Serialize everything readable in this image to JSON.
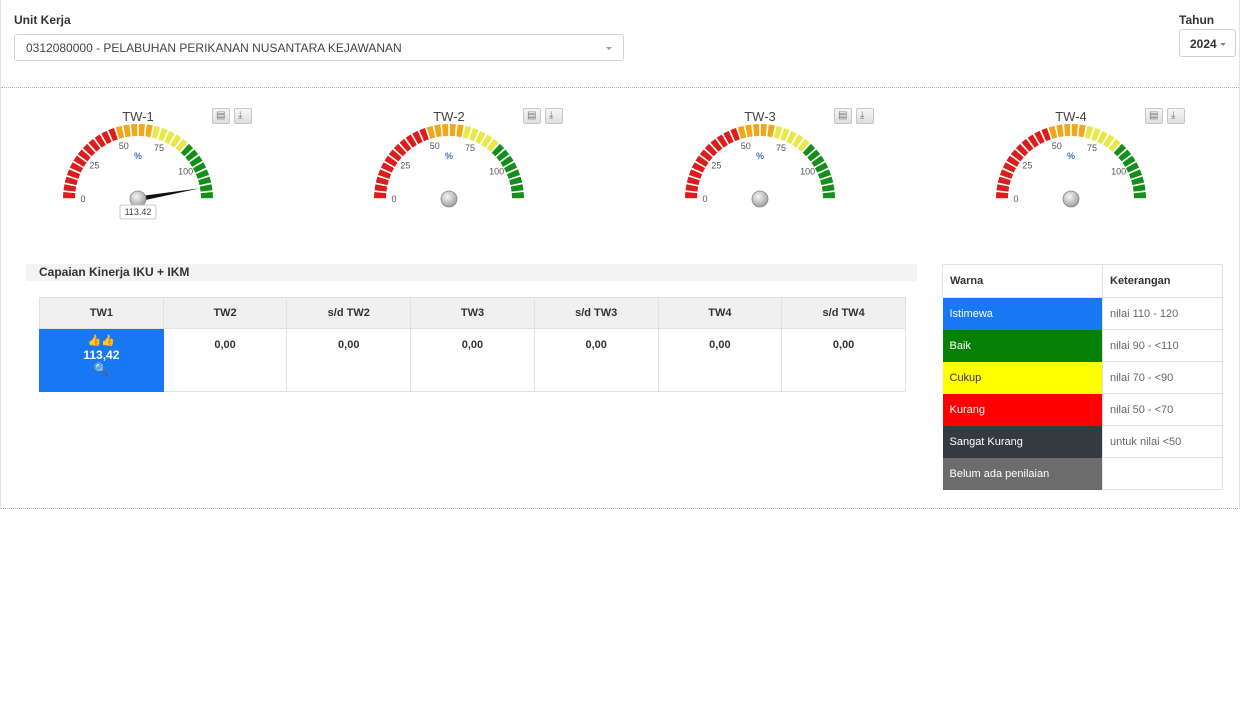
{
  "filter": {
    "unit_label": "Unit Kerja",
    "unit_value": "0312080000 - PELABUHAN PERIKANAN NUSANTARA KEJAWANAN",
    "year_label": "Tahun",
    "year_value": "2024"
  },
  "gauge_scale": {
    "min": 0,
    "max": 120,
    "tick_labels": [
      "0",
      "25",
      "50",
      "75",
      "100"
    ],
    "unit": "%"
  },
  "gauges": [
    {
      "title": "TW-1",
      "value": 113.42,
      "value_label": "113.42"
    },
    {
      "title": "TW-2",
      "value": null,
      "value_label": ""
    },
    {
      "title": "TW-3",
      "value": null,
      "value_label": ""
    },
    {
      "title": "TW-4",
      "value": null,
      "value_label": ""
    }
  ],
  "gauge_colors": {
    "red": "#dd1c1c",
    "orange": "#f0a81a",
    "yellow": "#e8e84a",
    "green": "#148f1a"
  },
  "gauge_buttons": {
    "print_icon": "printer-icon",
    "download_icon": "download-icon"
  },
  "performance": {
    "title": "Capaian Kinerja IKU + IKM",
    "headers": [
      "TW1",
      "TW2",
      "s/d TW2",
      "TW3",
      "s/d TW3",
      "TW4",
      "s/d TW4"
    ],
    "values": [
      "113,42",
      "0,00",
      "0,00",
      "0,00",
      "0,00",
      "0,00",
      "0,00"
    ],
    "highlight_color": "#1877f2",
    "highlight_icons": [
      "thumbs-up-icon",
      "search-icon"
    ]
  },
  "legend": {
    "headers": [
      "Warna",
      "Keterangan"
    ],
    "rows": [
      {
        "name": "Istimewa",
        "desc": "nilai 110 - 120",
        "color": "#1877f2"
      },
      {
        "name": "Baik",
        "desc": "nilai 90 - <110",
        "color": "#078007"
      },
      {
        "name": "Cukup",
        "desc": "nilai 70 - <90",
        "color": "#ffff00"
      },
      {
        "name": "Kurang",
        "desc": "nilai 50 - <70",
        "color": "#ff0000"
      },
      {
        "name": "Sangat Kurang",
        "desc": "untuk nilai <50",
        "color": "#343a40"
      },
      {
        "name": "Belum ada penilaian",
        "desc": "",
        "color": "#6c6c6c"
      }
    ]
  }
}
